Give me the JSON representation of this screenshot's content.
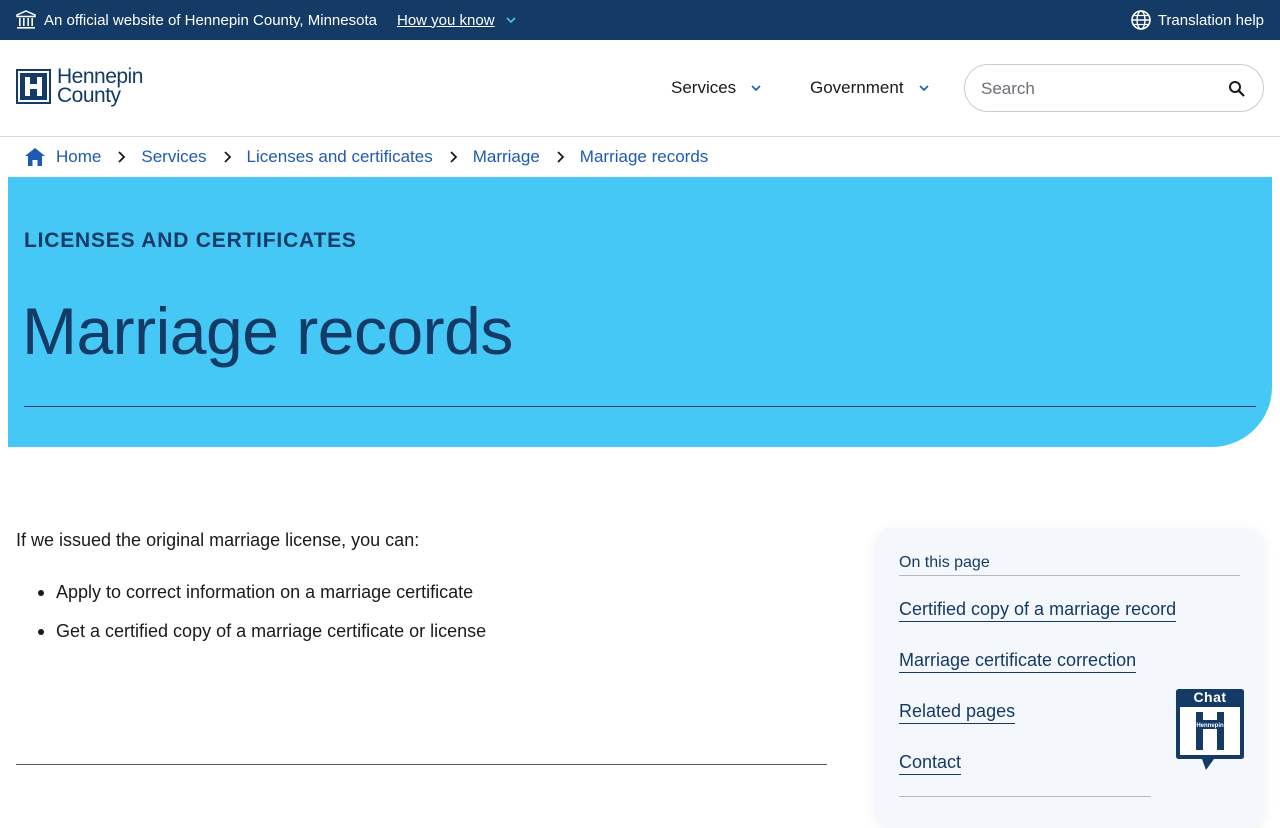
{
  "banner": {
    "official_text": "An official website of Hennepin County, Minnesota",
    "how_you_know": "How you know",
    "translation_help": "Translation help"
  },
  "header": {
    "logo_line1": "Hennepin",
    "logo_line2": "County",
    "nav": [
      {
        "label": "Services"
      },
      {
        "label": "Government"
      }
    ],
    "search": {
      "placeholder": "Search"
    }
  },
  "breadcrumb": [
    {
      "label": "Home"
    },
    {
      "label": "Services"
    },
    {
      "label": "Licenses and certificates"
    },
    {
      "label": "Marriage"
    },
    {
      "label": "Marriage records"
    }
  ],
  "hero": {
    "eyebrow": "LICENSES AND CERTIFICATES",
    "title": "Marriage records"
  },
  "main": {
    "intro": "If we issued the original marriage license, you can:",
    "bullets": [
      "Apply to correct information on a marriage certificate",
      "Get a certified copy of a marriage certificate or license"
    ]
  },
  "toc": {
    "heading": "On this page",
    "links": [
      "Certified copy of a marriage record",
      "Marriage certificate correction",
      "Related pages",
      "Contact"
    ]
  },
  "chat": {
    "label": "Chat",
    "logo_text": "Hennepin"
  },
  "colors": {
    "navy": "#143a66",
    "hero_blue": "#45c8f5",
    "link_blue": "#1d5bb3"
  }
}
